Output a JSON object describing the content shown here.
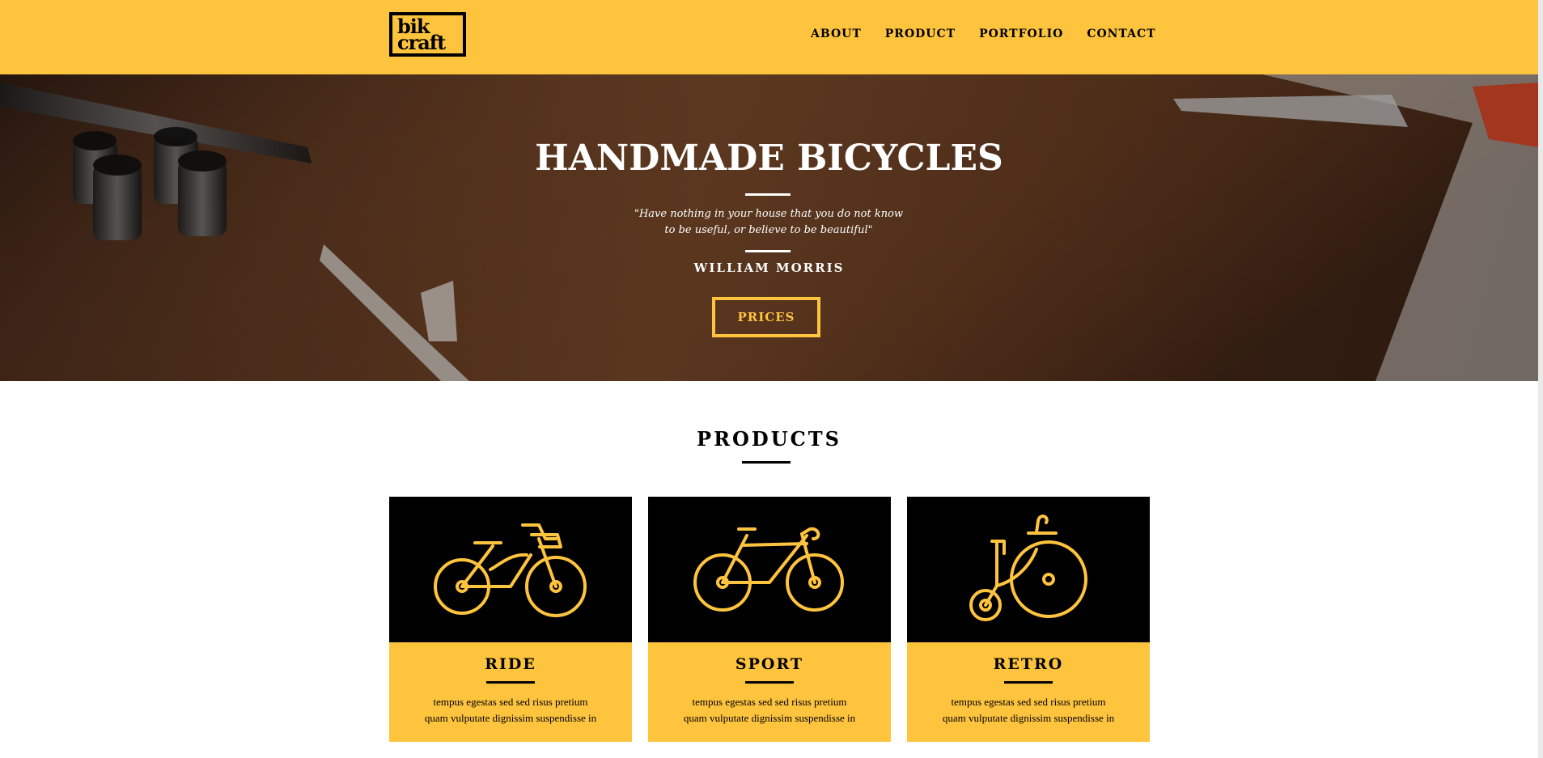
{
  "header": {
    "logo_line1": "bik",
    "logo_line2": "craft",
    "nav": [
      "ABOUT",
      "PRODUCT",
      "PORTFOLIO",
      "CONTACT"
    ]
  },
  "hero": {
    "title": "HANDMADE BICYCLES",
    "quote_line1": "\"Have nothing in your house that you do not know",
    "quote_line2": "to be useful, or believe to be beautiful\"",
    "author": "WILLIAM MORRIS",
    "button": "PRICES"
  },
  "products": {
    "title": "PRODUCTS",
    "items": [
      {
        "title": "RIDE",
        "icon": "city-bicycle-icon",
        "text_line1": "tempus egestas sed sed risus pretium",
        "text_line2": "quam vulputate dignissim suspendisse in"
      },
      {
        "title": "SPORT",
        "icon": "sport-bicycle-icon",
        "text_line1": "tempus egestas sed sed risus pretium",
        "text_line2": "quam vulputate dignissim suspendisse in"
      },
      {
        "title": "RETRO",
        "icon": "penny-farthing-icon",
        "text_line1": "tempus egestas sed sed risus pretium",
        "text_line2": "quam vulputate dignissim suspendisse in"
      }
    ]
  },
  "colors": {
    "accent": "#ffc43e",
    "dark": "#000000",
    "text_light": "#ffffff"
  }
}
